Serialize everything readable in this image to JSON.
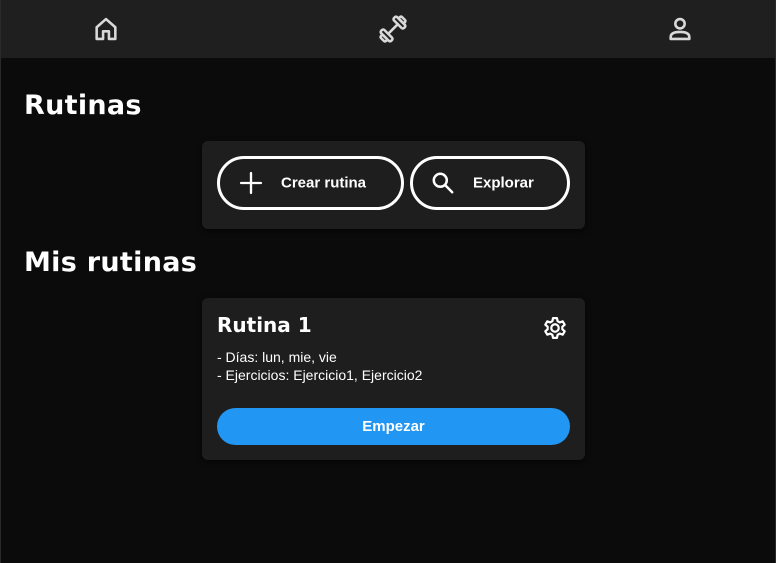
{
  "navbar": {
    "items": [
      {
        "icon": "home-icon"
      },
      {
        "icon": "dumbbell-icon"
      },
      {
        "icon": "user-icon"
      }
    ]
  },
  "routines_section": {
    "title": "Rutinas",
    "actions": [
      {
        "label": "Crear rutina",
        "icon": "plus-icon"
      },
      {
        "label": "Explorar",
        "icon": "search-icon"
      }
    ]
  },
  "my_routines_section": {
    "title": "Mis rutinas",
    "routines": [
      {
        "name": "Rutina 1",
        "days_line": "- Días: lun, mie, vie",
        "exercises_line": "- Ejercicios: Ejercicio1, Ejercicio2",
        "start_label": "Empezar",
        "settings_icon": "gear-icon"
      }
    ]
  },
  "colors": {
    "background": "#0b0b0b",
    "navbar": "#1f1f1f",
    "card": "#1e1e1e",
    "accent": "#2196f3",
    "text": "#ffffff",
    "icon": "#d9d9d9"
  }
}
